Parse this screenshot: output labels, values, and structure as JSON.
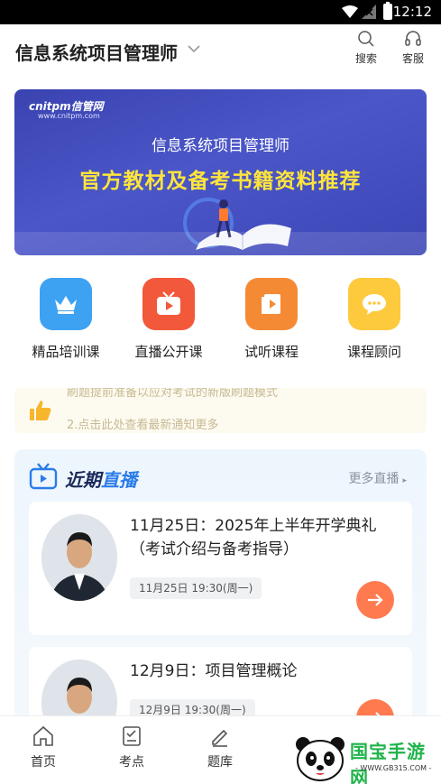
{
  "status_bar": {
    "time": "12:12"
  },
  "header": {
    "title": "信息系统项目管理师",
    "search_label": "搜索",
    "service_label": "客服"
  },
  "banner": {
    "logo": "cnitpm信管网",
    "logo_url": "www.cnitpm.com",
    "title": "信息系统项目管理师",
    "subtitle": "官方教材及备考书籍资料推荐"
  },
  "quick_menu": [
    {
      "label": "精品培训课",
      "icon": "crown-icon",
      "color": "#3ea2f2"
    },
    {
      "label": "直播公开课",
      "icon": "tv-play-icon",
      "color": "#f2583a"
    },
    {
      "label": "试听课程",
      "icon": "book-play-icon",
      "color": "#f58a35"
    },
    {
      "label": "课程顾问",
      "icon": "chat-bubble-icon",
      "color": "#fdc93d"
    }
  ],
  "notice": {
    "line1": "刷题提前准备以应对考试的新版刷题模式",
    "line2": "2.点击此处查看最新通知更多"
  },
  "live_section": {
    "title_a": "近期",
    "title_b": "直播",
    "more_label": "更多直播",
    "items": [
      {
        "title": "11月25日：2025年上半年开学典礼（考试介绍与备考指导）",
        "time": "11月25日 19:30(周一)"
      },
      {
        "title": "12月9日：项目管理概论",
        "time": "12月9日 19:30(周一)"
      }
    ]
  },
  "bottom_nav": [
    {
      "label": "首页",
      "icon": "home-icon"
    },
    {
      "label": "考点",
      "icon": "checklist-icon"
    },
    {
      "label": "题库",
      "icon": "pencil-icon"
    }
  ],
  "watermark": {
    "text": "国宝手游网",
    "url": "- WWW.GB315.COM -"
  }
}
